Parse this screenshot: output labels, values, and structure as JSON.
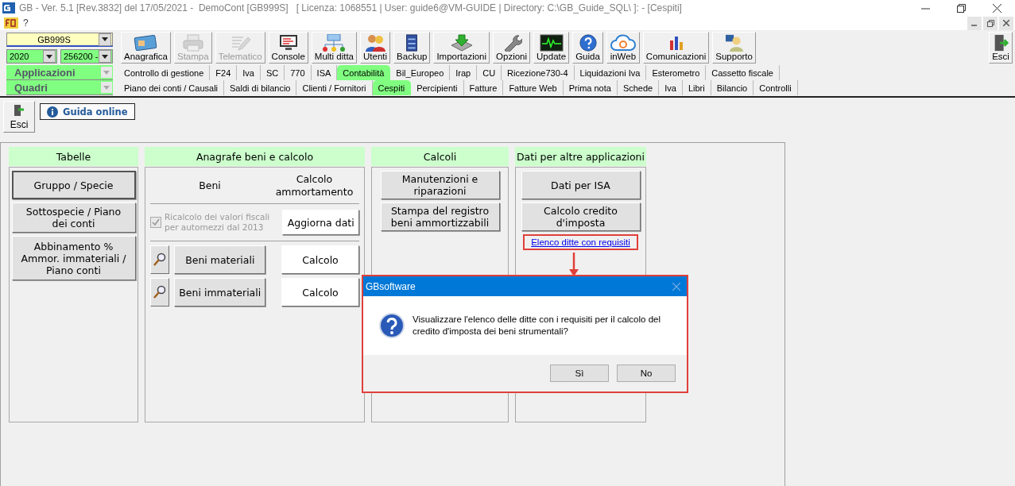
{
  "window": {
    "title": "GB - Ver. 5.1 [Rev.3832] del 17/05/2021 -  DemoCont [GB999S]   [ Licenza: 1068551 | User: guide6@VM-GUIDE | Directory: C:\\GB_Guide_SQL\\ ]: - [Cespiti]"
  },
  "menu": [
    "?"
  ],
  "selectors": {
    "company": "GB999S",
    "year": "2020",
    "code": "256200 -"
  },
  "toolbar": [
    {
      "label": "Anagrafica",
      "kind": "card",
      "disabled": false
    },
    {
      "label": "Stampa",
      "kind": "printer",
      "disabled": true
    },
    {
      "label": "Telematico",
      "kind": "pen",
      "disabled": true
    },
    {
      "label": "Console",
      "kind": "monitor",
      "disabled": false
    },
    {
      "label": "Multi ditta",
      "kind": "network",
      "disabled": false
    },
    {
      "label": "Utenti",
      "kind": "users",
      "disabled": false
    },
    {
      "label": "Backup",
      "kind": "cabinet",
      "disabled": false
    },
    {
      "label": "Importazioni",
      "kind": "download",
      "disabled": false
    },
    {
      "label": "Opzioni",
      "kind": "wrench",
      "disabled": false
    },
    {
      "label": "Update",
      "kind": "pulse",
      "disabled": false
    },
    {
      "label": "Guida",
      "kind": "help",
      "disabled": false
    },
    {
      "label": "inWeb",
      "kind": "cloud",
      "disabled": false
    },
    {
      "label": "Comunicazioni",
      "kind": "bars",
      "disabled": false
    },
    {
      "label": "Supporto",
      "kind": "person",
      "disabled": false
    }
  ],
  "exit_button": "Esci",
  "tab_rows": [
    {
      "label": "Applicazioni",
      "tabs": [
        {
          "label": "Controllo di gestione",
          "selected": false
        },
        {
          "label": "F24",
          "selected": false
        },
        {
          "label": "Iva",
          "selected": false
        },
        {
          "label": "SC",
          "selected": false
        },
        {
          "label": "770",
          "selected": false
        },
        {
          "label": "ISA",
          "selected": false
        },
        {
          "label": "Contabilità",
          "selected": true
        },
        {
          "label": "Bil_Europeo",
          "selected": false
        },
        {
          "label": "Irap",
          "selected": false
        },
        {
          "label": "CU",
          "selected": false
        },
        {
          "label": "Ricezione730-4",
          "selected": false
        },
        {
          "label": "Liquidazioni Iva",
          "selected": false
        },
        {
          "label": "Esterometro",
          "selected": false
        },
        {
          "label": "Cassetto fiscale",
          "selected": false
        }
      ]
    },
    {
      "label": "Quadri",
      "tabs": [
        {
          "label": "Piano dei conti / Causali",
          "selected": false
        },
        {
          "label": "Saldi di bilancio",
          "selected": false
        },
        {
          "label": "Clienti / Fornitori",
          "selected": false
        },
        {
          "label": "Cespiti",
          "selected": true
        },
        {
          "label": "Percipienti",
          "selected": false
        },
        {
          "label": "Fatture",
          "selected": false
        },
        {
          "label": "Fatture Web",
          "selected": false
        },
        {
          "label": "Prima nota",
          "selected": false
        },
        {
          "label": "Schede",
          "selected": false
        },
        {
          "label": "Iva",
          "selected": false
        },
        {
          "label": "Libri",
          "selected": false
        },
        {
          "label": "Bilancio",
          "selected": false
        },
        {
          "label": "Controlli",
          "selected": false
        }
      ]
    }
  ],
  "page": {
    "exit_button": "Esci",
    "help_button": "Guida online"
  },
  "tabelle": {
    "title": "Tabelle",
    "buttons": [
      "Gruppo / Specie",
      "Sottospecie / Piano dei conti",
      "Abbinamento % Ammor. immateriali / Piano conti"
    ]
  },
  "anagrafe": {
    "title": "Anagrafe beni e calcolo",
    "column_1": "Beni",
    "column_2": "Calcolo ammortamento",
    "recalc": {
      "label": "Ricalcolo dei valori fiscali per automezzi dal 2013",
      "checked": true,
      "disabled": true
    },
    "update_button": "Aggiorna dati",
    "rows": [
      {
        "button": "Beni materiali",
        "calc_button": "Calcolo"
      },
      {
        "button": "Beni immateriali",
        "calc_button": "Calcolo"
      }
    ]
  },
  "calcoli": {
    "title": "Calcoli",
    "buttons": [
      "Manutenzioni e riparazioni",
      "Stampa del registro beni ammortizzabili"
    ]
  },
  "altre": {
    "title": "Dati per altre applicazioni",
    "buttons": [
      "Dati per ISA",
      "Calcolo credito d'imposta"
    ],
    "link": "Elenco ditte con requisiti"
  },
  "dialog": {
    "title": "GBsoftware",
    "message": "Visualizzare l'elenco delle ditte con i requisiti per il calcolo del credito d'imposta dei beni strumentali?",
    "buttons": [
      "Sì",
      "No"
    ]
  }
}
